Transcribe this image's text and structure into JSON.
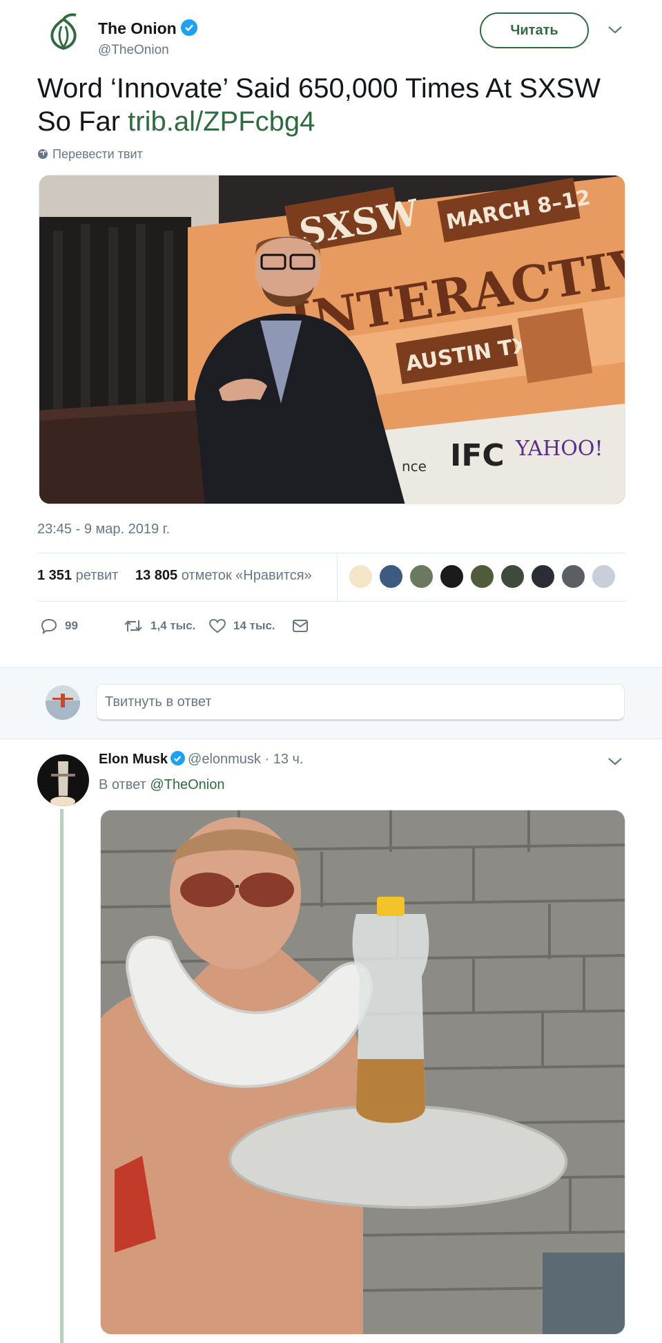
{
  "tweet": {
    "author_name": "The Onion",
    "author_handle": "@TheOnion",
    "follow_label": "Читать",
    "text_main": "Word ‘Innovate’ Said 650,000 Times At SXSW So Far ",
    "text_link": "trib.al/ZPFcbg4",
    "translate_label": "Перевести твит",
    "timestamp": "23:45 - 9 мар. 2019 г.",
    "retweets_count": "1 351",
    "retweets_label": " ретвит",
    "likes_count": "13 805",
    "likes_label": " отметок «Нравится»",
    "replies_short": "99",
    "retweets_short": "1,4 тыс.",
    "likes_short": "14 тыс.",
    "brand_color": "#2f6b3f"
  },
  "reply_box": {
    "placeholder": "Твитнуть в ответ"
  },
  "reply": {
    "author_name": "Elon Musk",
    "author_handle": "@elonmusk",
    "time": "· 13 ч.",
    "in_reply_prefix": "В ответ ",
    "in_reply_mention": "@TheOnion"
  },
  "icons": [
    "onion-logo-icon",
    "verified-icon",
    "chevron-down-icon",
    "globe-icon",
    "reply-icon",
    "retweet-icon",
    "heart-icon",
    "dm-icon"
  ]
}
